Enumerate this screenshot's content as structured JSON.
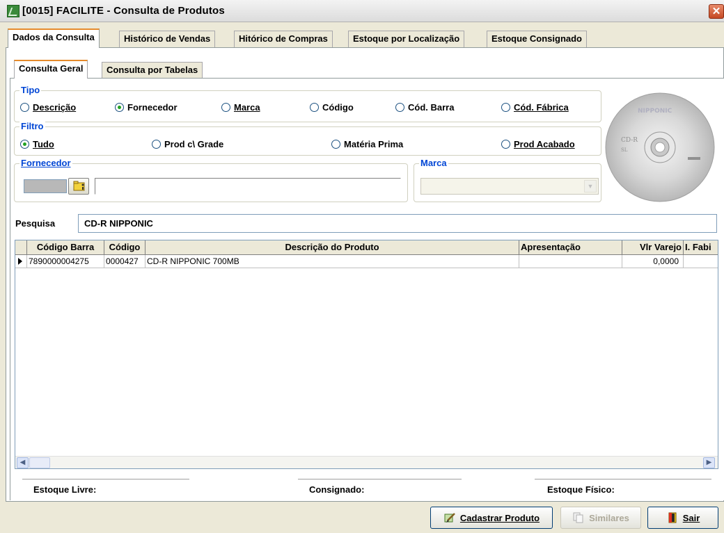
{
  "window": {
    "title": "[0015] FACILITE - Consulta de Produtos",
    "close": "✕"
  },
  "tabs": [
    "Dados da Consulta",
    "Histórico de Vendas",
    "Hitórico de Compras",
    "Estoque por Localização",
    "Estoque Consignado"
  ],
  "subtabs": [
    "Consulta Geral",
    "Consulta por Tabelas"
  ],
  "tipo": {
    "title": "Tipo",
    "options": [
      "Descrição",
      "Fornecedor",
      "Marca",
      "Código",
      "Cód. Barra",
      "Cód. Fábrica"
    ],
    "selected": "Fornecedor"
  },
  "filtro": {
    "title": "Filtro",
    "options": [
      "Tudo",
      "Prod c\\ Grade",
      "Matéria Prima",
      "Prod Acabado"
    ],
    "selected": "Tudo"
  },
  "fornecedor": {
    "title": "Fornecedor",
    "code_value": "",
    "name_value": ""
  },
  "marca": {
    "title": "Marca",
    "value": ""
  },
  "product_image": {
    "icon": "cd-disc-icon",
    "brand": "NIPPONIC",
    "line1": "CD-R",
    "line2": "SL"
  },
  "pesquisa": {
    "label": "Pesquisa",
    "value": "CD-R NIPPONIC"
  },
  "grid": {
    "columns": [
      "Código Barra",
      "Código",
      "Descrição do Produto",
      "Apresentação",
      "Vlr Varejo",
      "I. Fabi"
    ],
    "rows": [
      {
        "codigo_barra": "7890000004275",
        "codigo": "0000427",
        "descricao": "CD-R NIPPONIC 700MB",
        "apresentacao": "",
        "vlr_varejo": "0,0000",
        "fab": ""
      }
    ]
  },
  "footer": {
    "estoque_livre": "Estoque Livre:",
    "consignado": "Consignado:",
    "estoque_fisico": "Estoque Físico:"
  },
  "buttons": {
    "cadastrar": "Cadastrar Produto",
    "similares": "Similares",
    "sair": "Sair"
  },
  "colors": {
    "accent": "#0046d5",
    "tab_highlight": "#e68b2c",
    "radio_dot": "#21a121"
  }
}
